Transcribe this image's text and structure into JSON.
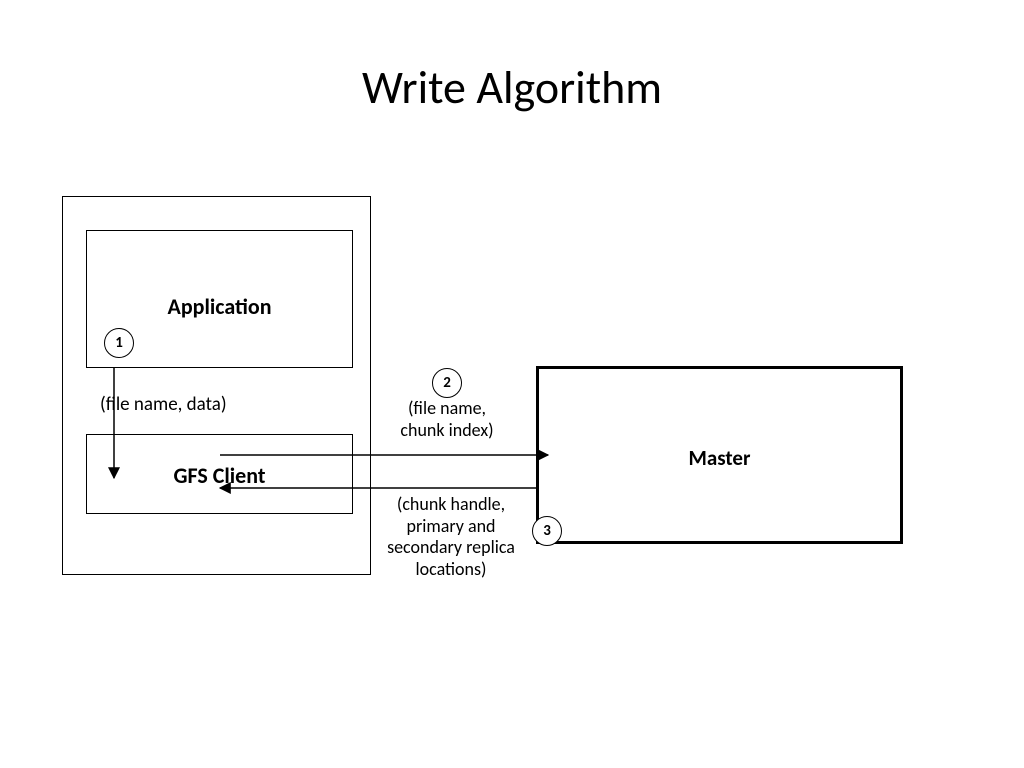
{
  "title": "Write Algorithm",
  "nodes": {
    "application": "Application",
    "gfs_client": "GFS Client",
    "master": "Master"
  },
  "steps": {
    "s1": "1",
    "s2": "2",
    "s3": "3"
  },
  "edges": {
    "e1": "(file name, data)",
    "e2": "(file name,\nchunk index)",
    "e3": "(chunk handle,\nprimary and\nsecondary replica\nlocations)"
  }
}
